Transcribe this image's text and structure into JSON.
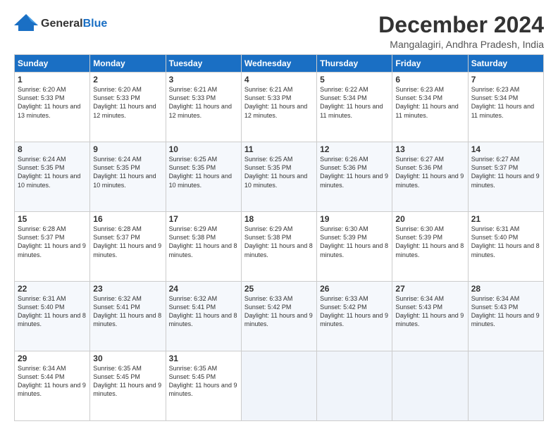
{
  "header": {
    "logo_general": "General",
    "logo_blue": "Blue",
    "month_title": "December 2024",
    "location": "Mangalagiri, Andhra Pradesh, India"
  },
  "weekdays": [
    "Sunday",
    "Monday",
    "Tuesday",
    "Wednesday",
    "Thursday",
    "Friday",
    "Saturday"
  ],
  "weeks": [
    [
      {
        "day": "1",
        "sunrise": "Sunrise: 6:20 AM",
        "sunset": "Sunset: 5:33 PM",
        "daylight": "Daylight: 11 hours and 13 minutes."
      },
      {
        "day": "2",
        "sunrise": "Sunrise: 6:20 AM",
        "sunset": "Sunset: 5:33 PM",
        "daylight": "Daylight: 11 hours and 12 minutes."
      },
      {
        "day": "3",
        "sunrise": "Sunrise: 6:21 AM",
        "sunset": "Sunset: 5:33 PM",
        "daylight": "Daylight: 11 hours and 12 minutes."
      },
      {
        "day": "4",
        "sunrise": "Sunrise: 6:21 AM",
        "sunset": "Sunset: 5:33 PM",
        "daylight": "Daylight: 11 hours and 12 minutes."
      },
      {
        "day": "5",
        "sunrise": "Sunrise: 6:22 AM",
        "sunset": "Sunset: 5:34 PM",
        "daylight": "Daylight: 11 hours and 11 minutes."
      },
      {
        "day": "6",
        "sunrise": "Sunrise: 6:23 AM",
        "sunset": "Sunset: 5:34 PM",
        "daylight": "Daylight: 11 hours and 11 minutes."
      },
      {
        "day": "7",
        "sunrise": "Sunrise: 6:23 AM",
        "sunset": "Sunset: 5:34 PM",
        "daylight": "Daylight: 11 hours and 11 minutes."
      }
    ],
    [
      {
        "day": "8",
        "sunrise": "Sunrise: 6:24 AM",
        "sunset": "Sunset: 5:35 PM",
        "daylight": "Daylight: 11 hours and 10 minutes."
      },
      {
        "day": "9",
        "sunrise": "Sunrise: 6:24 AM",
        "sunset": "Sunset: 5:35 PM",
        "daylight": "Daylight: 11 hours and 10 minutes."
      },
      {
        "day": "10",
        "sunrise": "Sunrise: 6:25 AM",
        "sunset": "Sunset: 5:35 PM",
        "daylight": "Daylight: 11 hours and 10 minutes."
      },
      {
        "day": "11",
        "sunrise": "Sunrise: 6:25 AM",
        "sunset": "Sunset: 5:35 PM",
        "daylight": "Daylight: 11 hours and 10 minutes."
      },
      {
        "day": "12",
        "sunrise": "Sunrise: 6:26 AM",
        "sunset": "Sunset: 5:36 PM",
        "daylight": "Daylight: 11 hours and 9 minutes."
      },
      {
        "day": "13",
        "sunrise": "Sunrise: 6:27 AM",
        "sunset": "Sunset: 5:36 PM",
        "daylight": "Daylight: 11 hours and 9 minutes."
      },
      {
        "day": "14",
        "sunrise": "Sunrise: 6:27 AM",
        "sunset": "Sunset: 5:37 PM",
        "daylight": "Daylight: 11 hours and 9 minutes."
      }
    ],
    [
      {
        "day": "15",
        "sunrise": "Sunrise: 6:28 AM",
        "sunset": "Sunset: 5:37 PM",
        "daylight": "Daylight: 11 hours and 9 minutes."
      },
      {
        "day": "16",
        "sunrise": "Sunrise: 6:28 AM",
        "sunset": "Sunset: 5:37 PM",
        "daylight": "Daylight: 11 hours and 9 minutes."
      },
      {
        "day": "17",
        "sunrise": "Sunrise: 6:29 AM",
        "sunset": "Sunset: 5:38 PM",
        "daylight": "Daylight: 11 hours and 8 minutes."
      },
      {
        "day": "18",
        "sunrise": "Sunrise: 6:29 AM",
        "sunset": "Sunset: 5:38 PM",
        "daylight": "Daylight: 11 hours and 8 minutes."
      },
      {
        "day": "19",
        "sunrise": "Sunrise: 6:30 AM",
        "sunset": "Sunset: 5:39 PM",
        "daylight": "Daylight: 11 hours and 8 minutes."
      },
      {
        "day": "20",
        "sunrise": "Sunrise: 6:30 AM",
        "sunset": "Sunset: 5:39 PM",
        "daylight": "Daylight: 11 hours and 8 minutes."
      },
      {
        "day": "21",
        "sunrise": "Sunrise: 6:31 AM",
        "sunset": "Sunset: 5:40 PM",
        "daylight": "Daylight: 11 hours and 8 minutes."
      }
    ],
    [
      {
        "day": "22",
        "sunrise": "Sunrise: 6:31 AM",
        "sunset": "Sunset: 5:40 PM",
        "daylight": "Daylight: 11 hours and 8 minutes."
      },
      {
        "day": "23",
        "sunrise": "Sunrise: 6:32 AM",
        "sunset": "Sunset: 5:41 PM",
        "daylight": "Daylight: 11 hours and 8 minutes."
      },
      {
        "day": "24",
        "sunrise": "Sunrise: 6:32 AM",
        "sunset": "Sunset: 5:41 PM",
        "daylight": "Daylight: 11 hours and 8 minutes."
      },
      {
        "day": "25",
        "sunrise": "Sunrise: 6:33 AM",
        "sunset": "Sunset: 5:42 PM",
        "daylight": "Daylight: 11 hours and 9 minutes."
      },
      {
        "day": "26",
        "sunrise": "Sunrise: 6:33 AM",
        "sunset": "Sunset: 5:42 PM",
        "daylight": "Daylight: 11 hours and 9 minutes."
      },
      {
        "day": "27",
        "sunrise": "Sunrise: 6:34 AM",
        "sunset": "Sunset: 5:43 PM",
        "daylight": "Daylight: 11 hours and 9 minutes."
      },
      {
        "day": "28",
        "sunrise": "Sunrise: 6:34 AM",
        "sunset": "Sunset: 5:43 PM",
        "daylight": "Daylight: 11 hours and 9 minutes."
      }
    ],
    [
      {
        "day": "29",
        "sunrise": "Sunrise: 6:34 AM",
        "sunset": "Sunset: 5:44 PM",
        "daylight": "Daylight: 11 hours and 9 minutes."
      },
      {
        "day": "30",
        "sunrise": "Sunrise: 6:35 AM",
        "sunset": "Sunset: 5:45 PM",
        "daylight": "Daylight: 11 hours and 9 minutes."
      },
      {
        "day": "31",
        "sunrise": "Sunrise: 6:35 AM",
        "sunset": "Sunset: 5:45 PM",
        "daylight": "Daylight: 11 hours and 9 minutes."
      },
      null,
      null,
      null,
      null
    ]
  ]
}
